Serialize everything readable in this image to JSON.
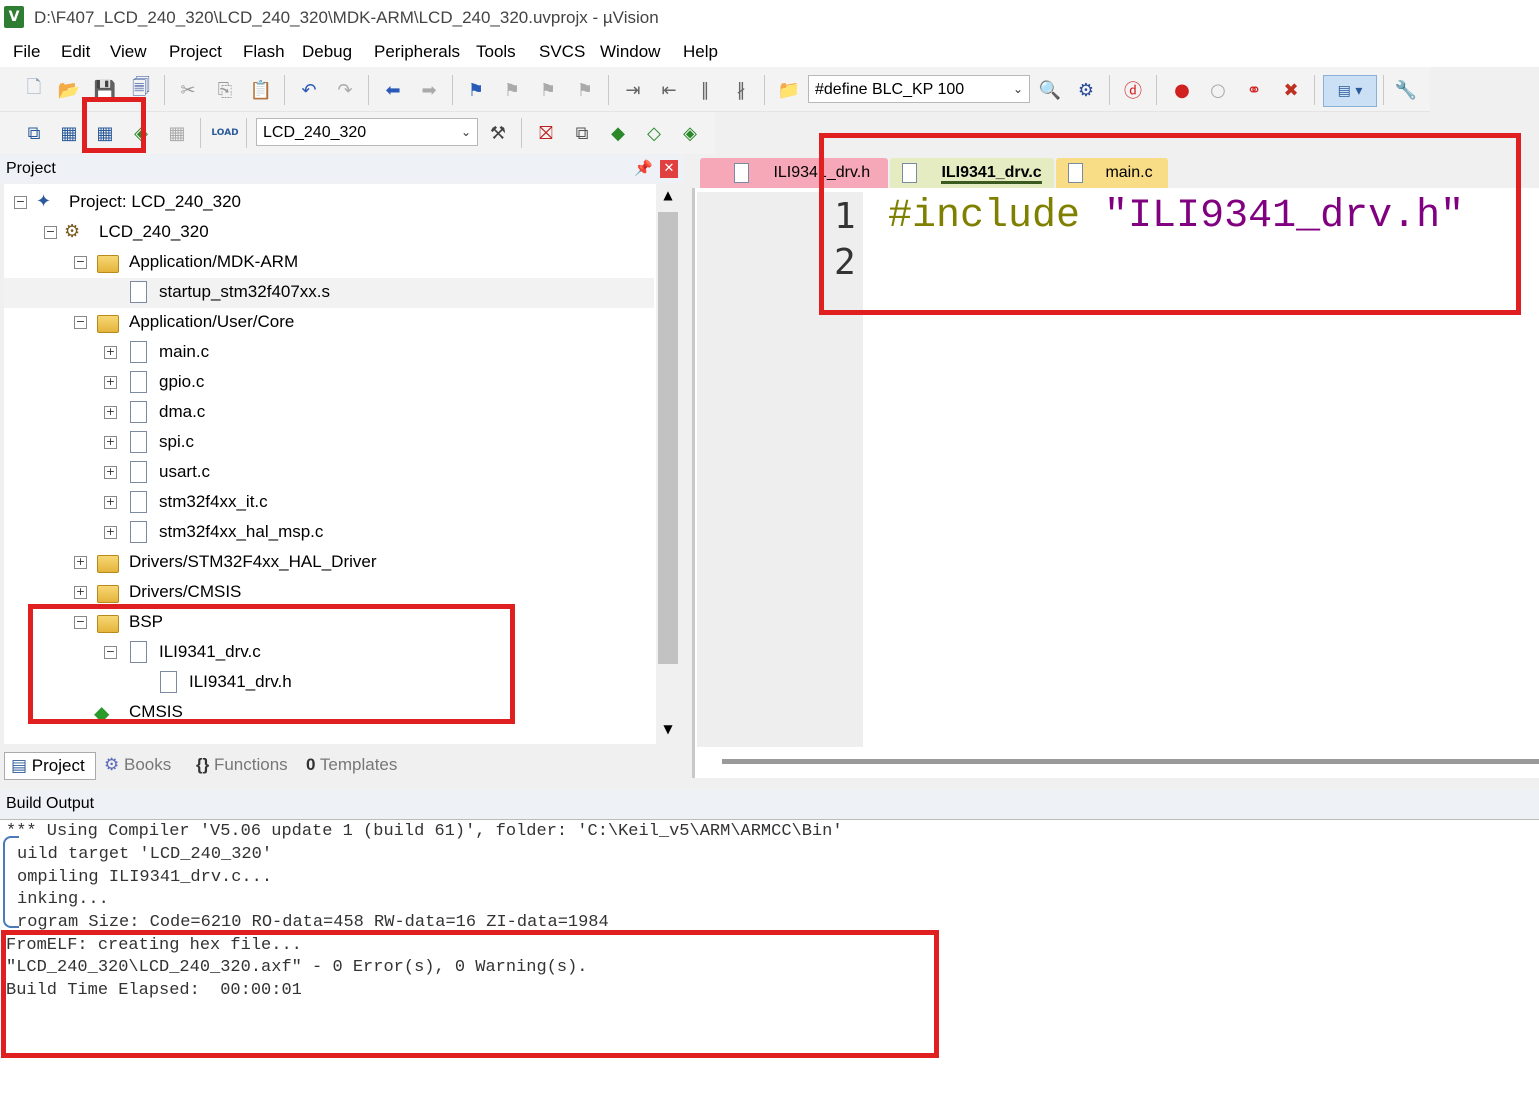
{
  "window": {
    "app_icon": "V",
    "title": "D:\\F407_LCD_240_320\\LCD_240_320\\MDK-ARM\\LCD_240_320.uvprojx - µVision"
  },
  "menu": [
    "File",
    "Edit",
    "View",
    "Project",
    "Flash",
    "Debug",
    "Peripherals",
    "Tools",
    "SVCS",
    "Window",
    "Help"
  ],
  "toolbar1": {
    "define_combo": "#define BLC_KP 100"
  },
  "toolbar2": {
    "load_label": "LOAD",
    "target_combo": "LCD_240_320"
  },
  "project_panel": {
    "title": "Project",
    "tree": [
      {
        "label": "Project: LCD_240_320",
        "kind": "root"
      },
      {
        "label": "LCD_240_320",
        "kind": "target"
      },
      {
        "label": "Application/MDK-ARM",
        "kind": "folder"
      },
      {
        "label": "startup_stm32f407xx.s",
        "kind": "file"
      },
      {
        "label": "Application/User/Core",
        "kind": "folder"
      },
      {
        "label": "main.c",
        "kind": "file"
      },
      {
        "label": "gpio.c",
        "kind": "file"
      },
      {
        "label": "dma.c",
        "kind": "file"
      },
      {
        "label": "spi.c",
        "kind": "file"
      },
      {
        "label": "usart.c",
        "kind": "file"
      },
      {
        "label": "stm32f4xx_it.c",
        "kind": "file"
      },
      {
        "label": "stm32f4xx_hal_msp.c",
        "kind": "file"
      },
      {
        "label": "Drivers/STM32F4xx_HAL_Driver",
        "kind": "folder"
      },
      {
        "label": "Drivers/CMSIS",
        "kind": "folder"
      },
      {
        "label": "BSP",
        "kind": "folder"
      },
      {
        "label": "ILI9341_drv.c",
        "kind": "file"
      },
      {
        "label": "ILI9341_drv.h",
        "kind": "file"
      },
      {
        "label": "CMSIS",
        "kind": "component"
      }
    ],
    "tabs": [
      "Project",
      "Books",
      "Functions",
      "Templates"
    ],
    "tab_glyphs": {
      "functions": "{}",
      "templates": "0"
    }
  },
  "editor": {
    "tabs": [
      "ILI9341_drv.h",
      "ILI9341_drv.c",
      "main.c"
    ],
    "line_numbers": [
      "1",
      "2"
    ],
    "code": {
      "line1_directive": "#include",
      "line1_string": "\"ILI9341_drv.h\""
    }
  },
  "build_output": {
    "title": "Build Output",
    "lines": [
      "*** Using Compiler 'V5.06 update 1 (build 61)', folder: 'C:\\Keil_v5\\ARM\\ARMCC\\Bin'",
      "uild target 'LCD_240_320'",
      "ompiling ILI9341_drv.c...",
      "inking...",
      "rogram Size: Code=6210 RO-data=458 RW-data=16 ZI-data=1984",
      "FromELF: creating hex file...",
      "\"LCD_240_320\\LCD_240_320.axf\" - 0 Error(s), 0 Warning(s).",
      "Build Time Elapsed:  00:00:01"
    ]
  },
  "colors": {
    "annotation_red": "#e02020",
    "include_directive": "#808000",
    "include_string": "#800080",
    "tab_h": "#f7a8b8",
    "tab_c": "#e6ecc2",
    "tab_main": "#f8dd86"
  }
}
